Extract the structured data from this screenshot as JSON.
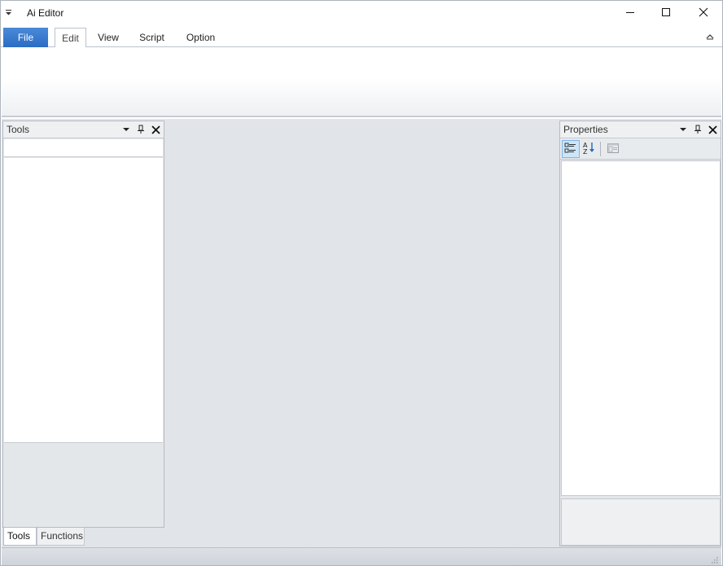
{
  "window": {
    "title": "Ai Editor"
  },
  "icons": {
    "qat": "quick-access-dropdown-icon",
    "minimize": "minimize-icon",
    "maximize": "maximize-icon",
    "close": "close-icon",
    "ribbon_collapse": "chevron-up-icon",
    "panel_menu": "chevron-down-icon",
    "panel_pin": "pin-icon",
    "panel_close": "close-icon",
    "categorized": "categorized-icon",
    "alphabetical": "sort-alphabetical-icon",
    "property_pages": "property-pages-icon",
    "resize_grip": "resize-grip-icon"
  },
  "ribbon": {
    "file_label": "File",
    "tabs": [
      {
        "label": "Edit",
        "selected": true
      },
      {
        "label": "View",
        "selected": false
      },
      {
        "label": "Script",
        "selected": false
      },
      {
        "label": "Option",
        "selected": false
      }
    ]
  },
  "tools_panel": {
    "title": "Tools",
    "search_value": "",
    "bottom_tabs": [
      {
        "label": "Tools",
        "selected": true
      },
      {
        "label": "Functions",
        "selected": false
      }
    ]
  },
  "properties_panel": {
    "title": "Properties"
  },
  "colors": {
    "file_tab": "#2b6cc4",
    "dock_background": "#e1e4e8",
    "active_toolbar_button": "#cde6f7"
  }
}
